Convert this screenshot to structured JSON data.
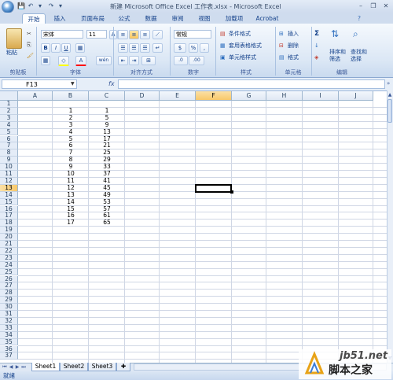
{
  "window": {
    "title": "新建 Microsoft Office Excel 工作表.xlsx - Microsoft Excel",
    "controls": [
      "–",
      "❐",
      "✕"
    ]
  },
  "qat": [
    "💾",
    "↶",
    "↷",
    "▾"
  ],
  "tabs": [
    {
      "label": "开始",
      "active": true
    },
    {
      "label": "插入",
      "active": false
    },
    {
      "label": "页面布局",
      "active": false
    },
    {
      "label": "公式",
      "active": false
    },
    {
      "label": "数据",
      "active": false
    },
    {
      "label": "审阅",
      "active": false
    },
    {
      "label": "视图",
      "active": false
    },
    {
      "label": "加载项",
      "active": false
    },
    {
      "label": "Acrobat",
      "active": false
    }
  ],
  "ribbon": {
    "clipboard": {
      "label": "剪贴板",
      "paste": "粘贴"
    },
    "font": {
      "label": "字体",
      "font_name": "宋体",
      "font_size": "11",
      "bold": "B",
      "italic": "I",
      "underline": "U",
      "grow": "A",
      "shrink": "A",
      "font_color": "A",
      "phonetic": "wén"
    },
    "alignment": {
      "label": "对齐方式"
    },
    "number": {
      "label": "数字",
      "format": "常规",
      "percent": "%",
      "comma": ",",
      "currency": "$",
      "inc_dec": ".0",
      "dec_dec": ".00"
    },
    "styles": {
      "label": "样式",
      "conditional": "条件格式",
      "table": "套用表格格式",
      "cell": "单元格样式"
    },
    "cells": {
      "label": "单元格",
      "insert": "插入",
      "delete": "删除",
      "format": "格式"
    },
    "editing": {
      "label": "编辑",
      "sum": "Σ",
      "sort": "排序和\n筛选",
      "find": "查找和\n选择"
    }
  },
  "formula_bar": {
    "name_box": "F13",
    "fx": "fx",
    "content": ""
  },
  "sheet": {
    "columns": [
      "A",
      "B",
      "C",
      "D",
      "E",
      "F",
      "G",
      "H",
      "I",
      "J"
    ],
    "selected_column": "F",
    "selected_row": 13,
    "rows": [
      "1",
      "2",
      "3",
      "4",
      "5",
      "6",
      "7",
      "8",
      "9",
      "10",
      "11",
      "12",
      "13",
      "14",
      "15",
      "16",
      "17",
      "18",
      "19",
      "20",
      "21",
      "22",
      "23",
      "24",
      "25",
      "26",
      "27",
      "28",
      "29",
      "30",
      "31",
      "32",
      "33",
      "34",
      "35",
      "36",
      "37"
    ],
    "col_b": [
      "",
      "1",
      "2",
      "3",
      "4",
      "5",
      "6",
      "7",
      "8",
      "9",
      "10",
      "11",
      "12",
      "13",
      "14",
      "15",
      "16",
      "17"
    ],
    "col_c": [
      "",
      "1",
      "5",
      "9",
      "13",
      "17",
      "21",
      "25",
      "29",
      "33",
      "37",
      "41",
      "45",
      "49",
      "53",
      "57",
      "61",
      "65"
    ]
  },
  "sheet_tabs": [
    {
      "label": "Sheet1",
      "active": true
    },
    {
      "label": "Sheet2",
      "active": false
    },
    {
      "label": "Sheet3",
      "active": false
    }
  ],
  "status": {
    "text": "就绪"
  },
  "watermark": {
    "url": "jb51.net",
    "text": "脚本之家"
  },
  "colors": {
    "accent": "#15428b",
    "ribbon": "#dbe7f5",
    "select": "#f8c86a"
  }
}
